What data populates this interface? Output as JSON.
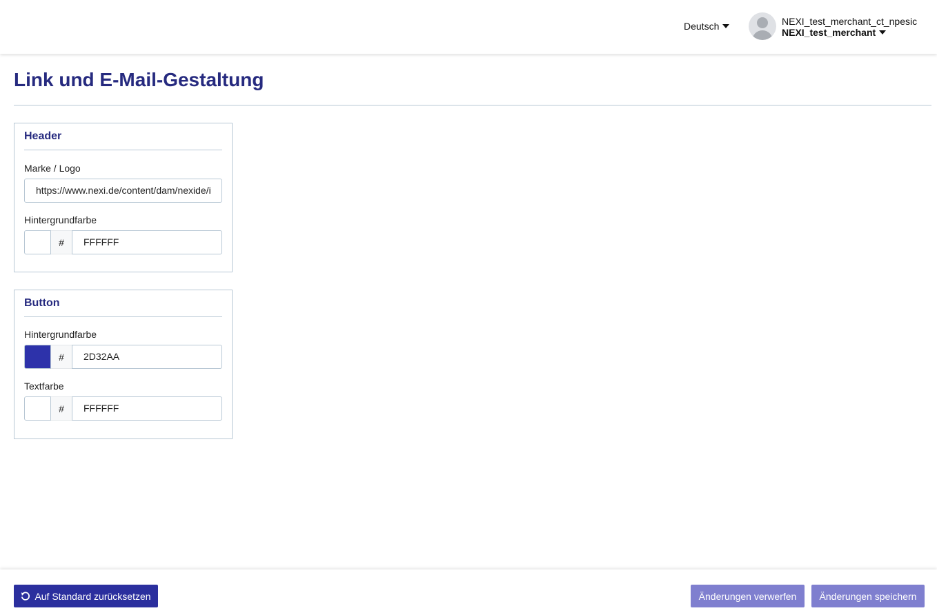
{
  "header": {
    "language": "Deutsch",
    "user_name": "NEXI_test_merchant_ct_npesic",
    "merchant": "NEXI_test_merchant"
  },
  "page": {
    "title": "Link und E-Mail-Gestaltung"
  },
  "header_card": {
    "title": "Header",
    "logo_label": "Marke / Logo",
    "logo_value": "https://www.nexi.de/content/dam/nexide/i",
    "bg_label": "Hintergrundfarbe",
    "bg_hash": "#",
    "bg_value": "FFFFFF",
    "bg_color": "#FFFFFF"
  },
  "button_card": {
    "title": "Button",
    "bg_label": "Hintergrundfarbe",
    "bg_hash": "#",
    "bg_value": "2D32AA",
    "bg_color": "#2D32AA",
    "text_label": "Textfarbe",
    "text_hash": "#",
    "text_value": "FFFFFF",
    "text_color": "#FFFFFF"
  },
  "footer": {
    "reset_label": "Auf Standard zurücksetzen",
    "discard_label": "Änderungen verwerfen",
    "save_label": "Änderungen speichern"
  },
  "icons": {
    "language_dropdown": "caret-down-icon",
    "merchant_dropdown": "caret-down-icon",
    "avatar": "user-avatar-icon",
    "reset": "undo-icon"
  },
  "colors": {
    "primary": "#2B2F9E",
    "title": "#262A7F",
    "disabled_button": "#7F7FCF",
    "border": "#B7C7D4"
  }
}
